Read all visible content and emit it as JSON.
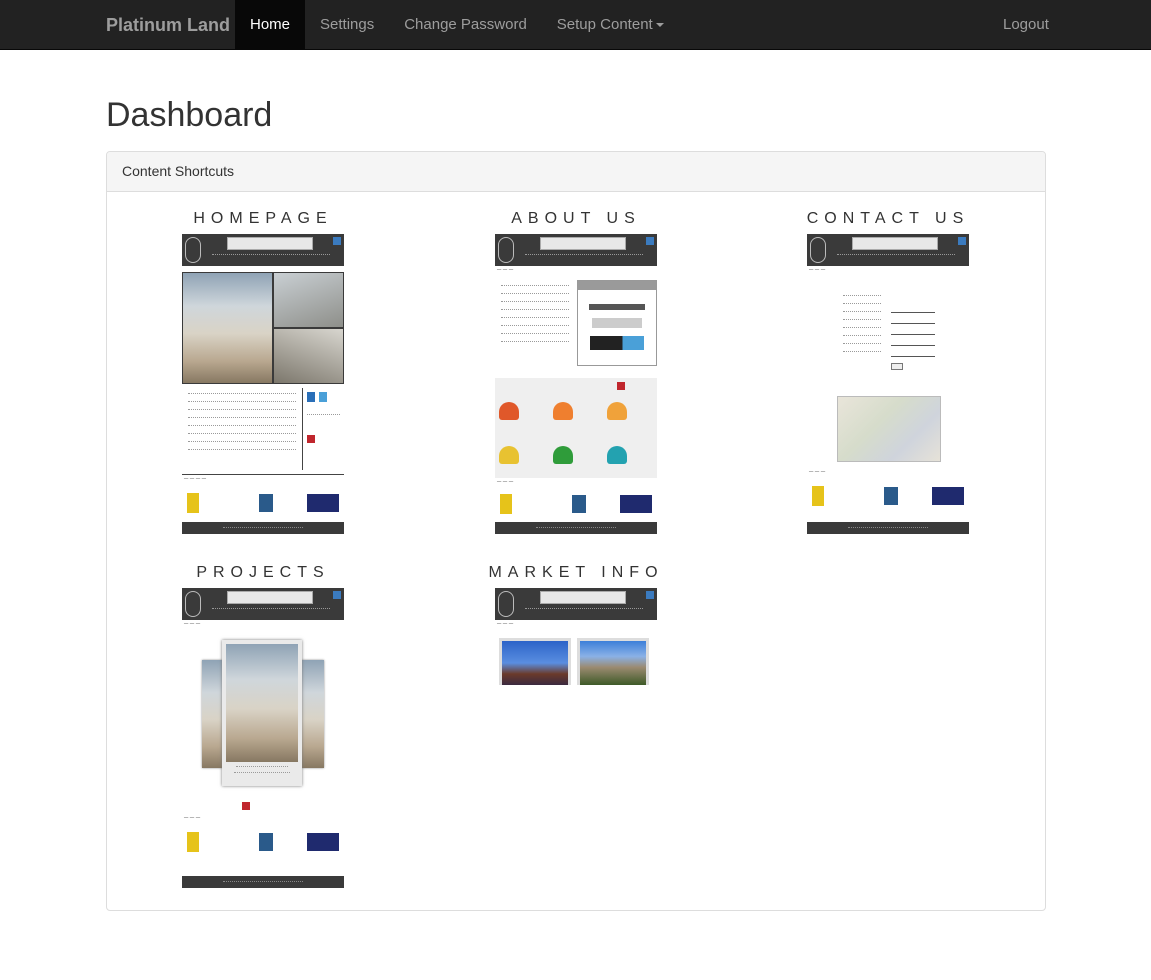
{
  "navbar": {
    "brand": "Platinum Land",
    "items": [
      {
        "label": "Home",
        "active": true
      },
      {
        "label": "Settings",
        "active": false
      },
      {
        "label": "Change Password",
        "active": false
      },
      {
        "label": "Setup Content",
        "active": false,
        "dropdown": true
      }
    ],
    "logout": "Logout",
    "colors": {
      "background": "#222222",
      "text": "#9d9d9d",
      "active_bg": "#080808",
      "active_text": "#ffffff"
    }
  },
  "page": {
    "title": "Dashboard",
    "panel": {
      "heading": "Content Shortcuts",
      "shortcuts": [
        {
          "label": "HOMEPAGE"
        },
        {
          "label": "ABOUT US"
        },
        {
          "label": "CONTACT US"
        },
        {
          "label": "PROJECTS"
        },
        {
          "label": "MARKET INFO"
        }
      ]
    }
  }
}
